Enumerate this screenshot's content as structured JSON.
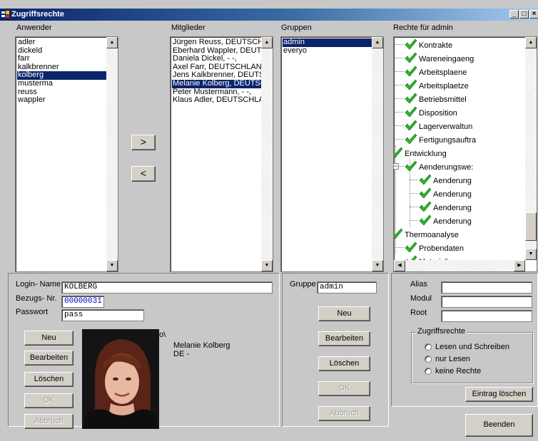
{
  "window": {
    "title": "Zugriffsrechte",
    "controls": {
      "minimize": "_",
      "maximize": "□",
      "close": "×"
    }
  },
  "users": {
    "label": "Anwender",
    "items": [
      "adler",
      "dickeld",
      "farr",
      "kalkbrenner",
      "kolberg",
      "musterma",
      "reuss",
      "wappler"
    ],
    "selected": "kolberg"
  },
  "members": {
    "label": "Mitglieder",
    "items": [
      "Jürgen Reuss, DEUTSCHL",
      "Eberhard Wappler, DEUTS",
      "Daniela Dickel,  - -,",
      "Axel Farr, DEUTSCHLAND",
      "Jens Kalkbrenner, DEUTS(",
      "Melanie Kolberg, DEUTSCI",
      "Peter Mustermann,  - -,",
      "Klaus Adler, DEUTSCHLAN"
    ],
    "selected": "Melanie Kolberg, DEUTSCI"
  },
  "move_buttons": {
    "add": ">",
    "remove": "<"
  },
  "groups": {
    "label": "Gruppen",
    "items": [
      "admin",
      "everyo"
    ],
    "selected": "admin"
  },
  "rights": {
    "label": "Rechte für admin",
    "tree": [
      {
        "label": "Kontrakte"
      },
      {
        "label": "Wareneingaeng"
      },
      {
        "label": "Arbeitsplaene"
      },
      {
        "label": "Arbeitsplaetze"
      },
      {
        "label": "Betriebsmittel"
      },
      {
        "label": "Disposition"
      },
      {
        "label": "Lagerverwaltun"
      },
      {
        "label": "Fertigungsauftra"
      },
      {
        "label": "Entwicklung",
        "expander": "−"
      },
      {
        "label": "Aenderungswe:",
        "expander": "−"
      },
      {
        "label": "Aenderung"
      },
      {
        "label": "Aenderung"
      },
      {
        "label": "Aenderung"
      },
      {
        "label": "Aenderung"
      },
      {
        "label": "Thermoanalyse",
        "expander": "−"
      },
      {
        "label": "Probendaten"
      },
      {
        "label": "Materialien"
      }
    ]
  },
  "user_form": {
    "login_label": "Login- Name",
    "login_value": "KOLBERG",
    "ref_label": "Bezugs- Nr.",
    "ref_value": "00000031",
    "password_label": "Passwort",
    "password_value": "pass",
    "buttons": {
      "new": "Neu",
      "edit": "Bearbeiten",
      "delete": "Löschen",
      "ok": "OK",
      "cancel": "Abbruch"
    },
    "person_name": "Melanie Kolberg",
    "person_country": "DE  -",
    "photo_overlay": "o\\"
  },
  "group_form": {
    "group_label": "Gruppe",
    "group_value": "admin",
    "buttons": {
      "new": "Neu",
      "edit": "Bearbeiten",
      "delete": "Löschen",
      "ok": "OK",
      "cancel": "Abbruch"
    }
  },
  "rights_form": {
    "alias_label": "Alias",
    "module_label": "Modul",
    "root_label": "Root",
    "alias_value": "",
    "module_value": "",
    "root_value": "",
    "access_group_label": "Zugriffsrechte",
    "options": [
      "Lesen und Schreiben",
      "nur Lesen",
      "keine Rechte"
    ],
    "delete_entry": "Eintrag löschen"
  },
  "end_button": "Beenden",
  "colors": {
    "title_start": "#0a246a",
    "title_end": "#a6caf0",
    "selection": "#0a246a",
    "check": "#2db52d",
    "ref_text": "#0000c8"
  }
}
